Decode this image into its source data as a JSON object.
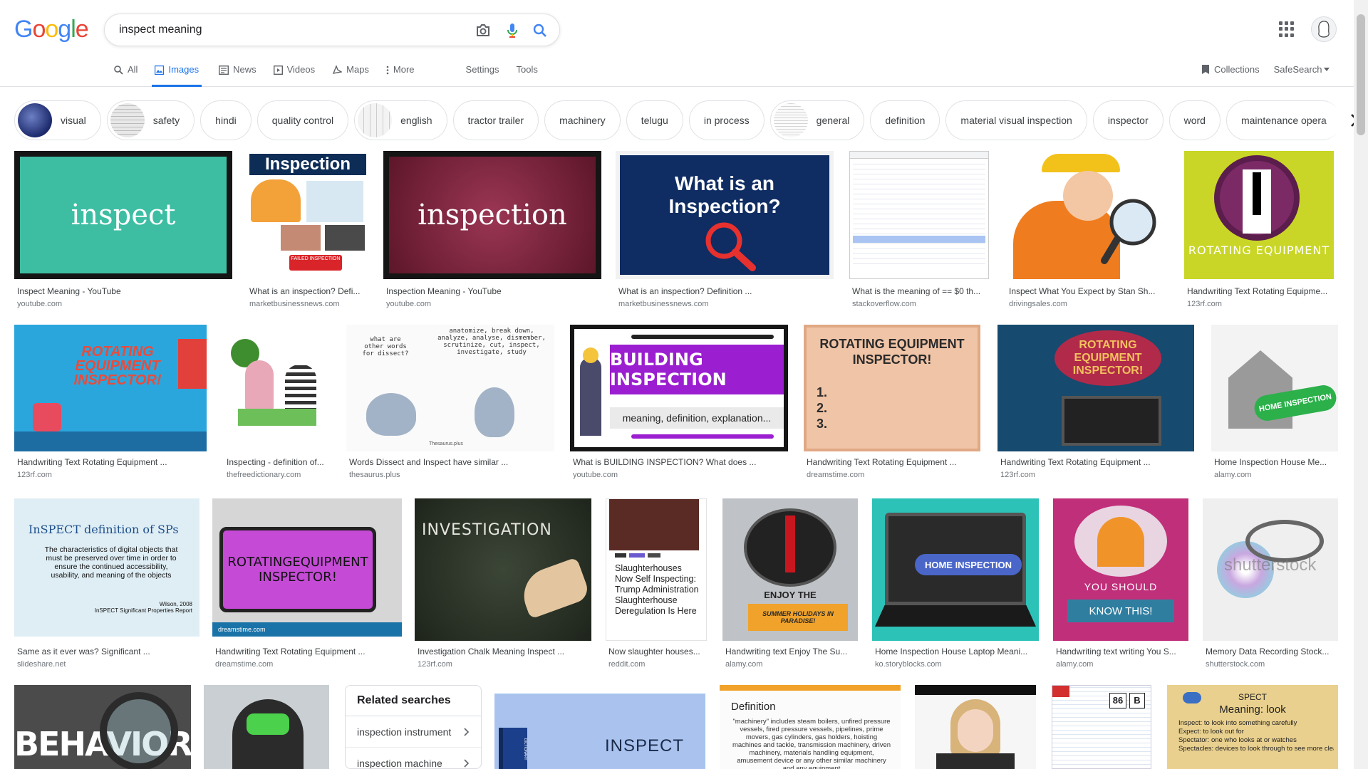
{
  "logo": {
    "letters": [
      "G",
      "o",
      "o",
      "g",
      "l",
      "e"
    ],
    "colors": [
      "#4285F4",
      "#EA4335",
      "#FBBC05",
      "#4285F4",
      "#34A853",
      "#EA4335"
    ]
  },
  "search": {
    "query": "inspect meaning"
  },
  "tabs": [
    {
      "label": "All",
      "icon": "search-icon"
    },
    {
      "label": "Images",
      "icon": "image-icon"
    },
    {
      "label": "News",
      "icon": "news-icon"
    },
    {
      "label": "Videos",
      "icon": "video-icon"
    },
    {
      "label": "Maps",
      "icon": "map-icon"
    },
    {
      "label": "More",
      "icon": "more-icon"
    },
    {
      "label": "Settings"
    },
    {
      "label": "Tools"
    }
  ],
  "right_links": {
    "collections": "Collections",
    "safesearch": "SafeSearch"
  },
  "chips": [
    "visual",
    "safety",
    "hindi",
    "quality control",
    "english",
    "tractor trailer",
    "machinery",
    "telugu",
    "in process",
    "general",
    "definition",
    "material visual inspection",
    "inspector",
    "word",
    "maintenance opera"
  ],
  "results": [
    {
      "caption": "Inspect Meaning - YouTube",
      "source": "youtube.com",
      "art_text": "inspect"
    },
    {
      "caption": "What is an inspection? Defi...",
      "source": "marketbusinessnews.com",
      "art_text": "Inspection",
      "art_text2": "FAILED INSPECTION"
    },
    {
      "caption": "Inspection Meaning - YouTube",
      "source": "youtube.com",
      "art_text": "inspection"
    },
    {
      "caption": "What is an inspection? Definition ...",
      "source": "marketbusinessnews.com",
      "art_text": "What is an Inspection?"
    },
    {
      "caption": "What is the meaning of == $0 th...",
      "source": "stackoverflow.com"
    },
    {
      "caption": "Inspect What You Expect by Stan Sh...",
      "source": "drivingsales.com"
    },
    {
      "caption": "Handwriting Text Rotating Equipme...",
      "source": "123rf.com",
      "art_text": "ROTATING EQUIPMENT"
    },
    {
      "caption": "Handwriting Text Rotating Equipment ...",
      "source": "123rf.com",
      "art_text": "ROTATING EQUIPMENT INSPECTOR!"
    },
    {
      "caption": "Inspecting - definition of...",
      "source": "thefreedictionary.com"
    },
    {
      "caption": "Words Dissect and Inspect have similar ...",
      "source": "thesaurus.plus",
      "art_text": "what are other words for dissect?",
      "art_text2": "anatomize, break down, analyze, analyse, dismember, scrutinize, cut, inspect, investigate, study",
      "art_text3": "Thesaurus.plus"
    },
    {
      "caption": "What is BUILDING INSPECTION? What does ...",
      "source": "youtube.com",
      "art_text": "BUILDING INSPECTION",
      "art_text2": "meaning, definition, explanation..."
    },
    {
      "caption": "Handwriting Text Rotating Equipment ...",
      "source": "dreamstime.com",
      "art_text": "ROTATING EQUIPMENT INSPECTOR!",
      "art_text2": "1.\n2.\n3."
    },
    {
      "caption": "Handwriting Text Rotating Equipment ...",
      "source": "123rf.com",
      "art_text": "ROTATING EQUIPMENT INSPECTOR!"
    },
    {
      "caption": "Home Inspection House Me...",
      "source": "alamy.com",
      "art_text": "HOME INSPECTION"
    },
    {
      "caption": "Same as it ever was? Significant ...",
      "source": "slideshare.net",
      "art_text": "InSPECT definition of SPs",
      "art_text2": "The characteristics of digital objects that must be preserved over time in order to ensure the continued accessibility, usability, and meaning of the objects",
      "art_text3": "Wilson, 2008\nInSPECT Significant Properties Report"
    },
    {
      "caption": "Handwriting Text Rotating Equipment ...",
      "source": "dreamstime.com",
      "art_text": "ROTATINGEQUIPMENT INSPECTOR!",
      "art_text2": "dreamstime.com"
    },
    {
      "caption": "Investigation Chalk Meaning Inspect ...",
      "source": "123rf.com",
      "art_text": "INVESTIGATION"
    },
    {
      "caption": "Now slaughter houses...",
      "source": "reddit.com",
      "art_text": "Slaughterhouses Now Self Inspecting: Trump Administration Slaughterhouse Deregulation Is Here"
    },
    {
      "caption": "Handwriting text Enjoy The Su...",
      "source": "alamy.com",
      "art_text": "ENJOY THE",
      "art_text2": "SUMMER HOLIDAYS IN PARADISE!"
    },
    {
      "caption": "Home Inspection House Laptop Meani...",
      "source": "ko.storyblocks.com",
      "art_text": "HOME INSPECTION"
    },
    {
      "caption": "Handwriting text writing You S...",
      "source": "alamy.com",
      "art_text": "YOU SHOULD",
      "art_text2": "KNOW THIS!"
    },
    {
      "caption": "Memory Data Recording Stock...",
      "source": "shutterstock.com",
      "art_text": "shutterstock"
    },
    {
      "art_text": "BEHAVIOR"
    },
    {},
    {
      "art_text": "INSPECT",
      "art_text2": "DICTIONARY"
    },
    {
      "art_text": "Definition",
      "art_text2": "\"machinery\" includes steam boilers, unfired pressure vessels, fired pressure vessels, pipelines, prime movers, gas cylinders, gas holders, hoisting machines and tackle, transmission machinery, driven machinery, materials handling equipment, amusement device or any other similar machinery and any equipment"
    },
    {},
    {
      "art_text": "86",
      "art_text2": "B"
    },
    {
      "art_text": "SPECT",
      "art_text2": "Meaning: look",
      "art_text3": "Inspect: to look into something carefully\nExpect: to look out for\nSpectator: one who looks at or watches\nSpectacles: devices to look through to see more clearly (glasses)"
    }
  ],
  "related": {
    "title": "Related searches",
    "items": [
      "inspection instrument",
      "inspection machine"
    ]
  }
}
